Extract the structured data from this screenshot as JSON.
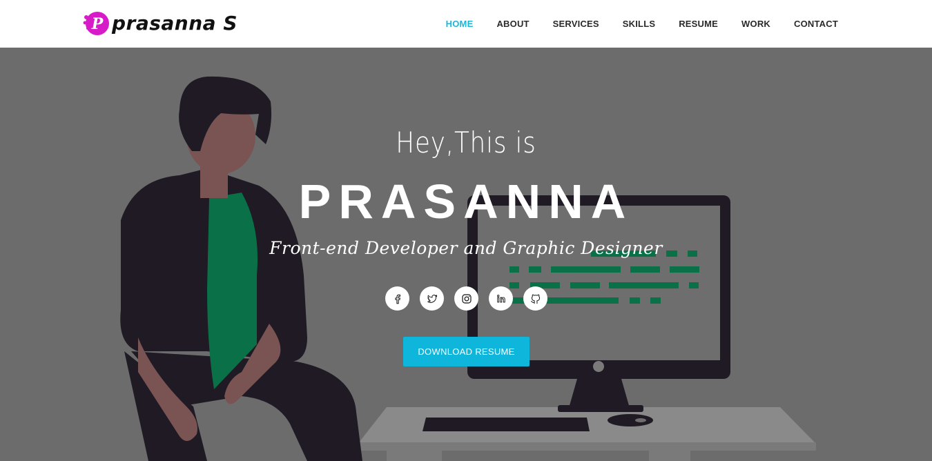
{
  "header": {
    "logo_text": "prasanna S",
    "logo_letter": "P",
    "nav": [
      {
        "label": "HOME",
        "active": true
      },
      {
        "label": "ABOUT"
      },
      {
        "label": "SERVICES"
      },
      {
        "label": "SKILLS"
      },
      {
        "label": "RESUME"
      },
      {
        "label": "WORK"
      },
      {
        "label": "CONTACT"
      }
    ]
  },
  "hero": {
    "greeting": "Hey,This is",
    "name": "PRASANNA",
    "role": "Front-end Developer and Graphic Designer",
    "social": [
      {
        "icon": "facebook-icon"
      },
      {
        "icon": "twitter-icon"
      },
      {
        "icon": "instagram-icon"
      },
      {
        "icon": "linkedin-icon"
      },
      {
        "icon": "github-icon"
      }
    ],
    "download_label": "DOWNLOAD RESUME"
  },
  "colors": {
    "accent": "#0fb6db",
    "nav_active": "#1fb5d6",
    "logo_magenta": "#d81bc8",
    "hero_overlay": "#6c6c6c"
  }
}
